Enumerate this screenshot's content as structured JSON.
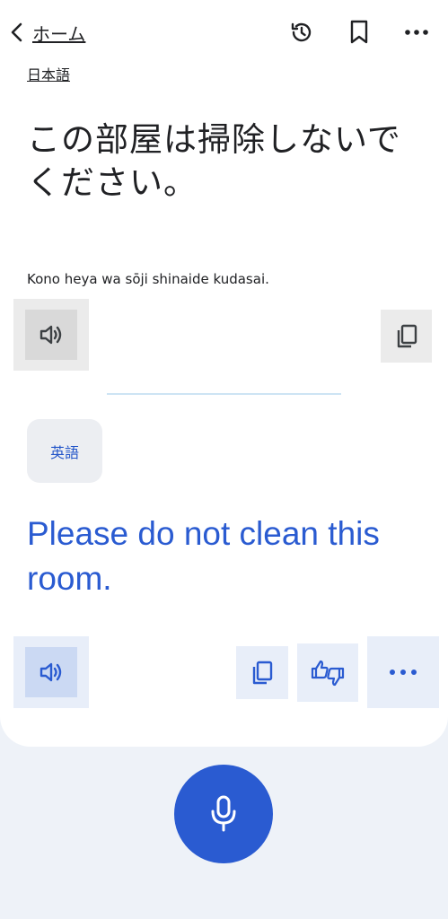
{
  "header": {
    "back_label": "ホーム",
    "icons": [
      "back-chevron-icon",
      "history-icon",
      "bookmark-icon",
      "more-icon"
    ]
  },
  "source": {
    "language": "日本語",
    "text": "この部屋は掃除しないでください。",
    "romanization": "Kono heya wa sōji shinaide kudasai."
  },
  "target": {
    "language": "英語",
    "text": "Please do not clean this room."
  },
  "colors": {
    "accent": "#2a5bd1",
    "background": "#eef2f8",
    "card": "#ffffff"
  }
}
